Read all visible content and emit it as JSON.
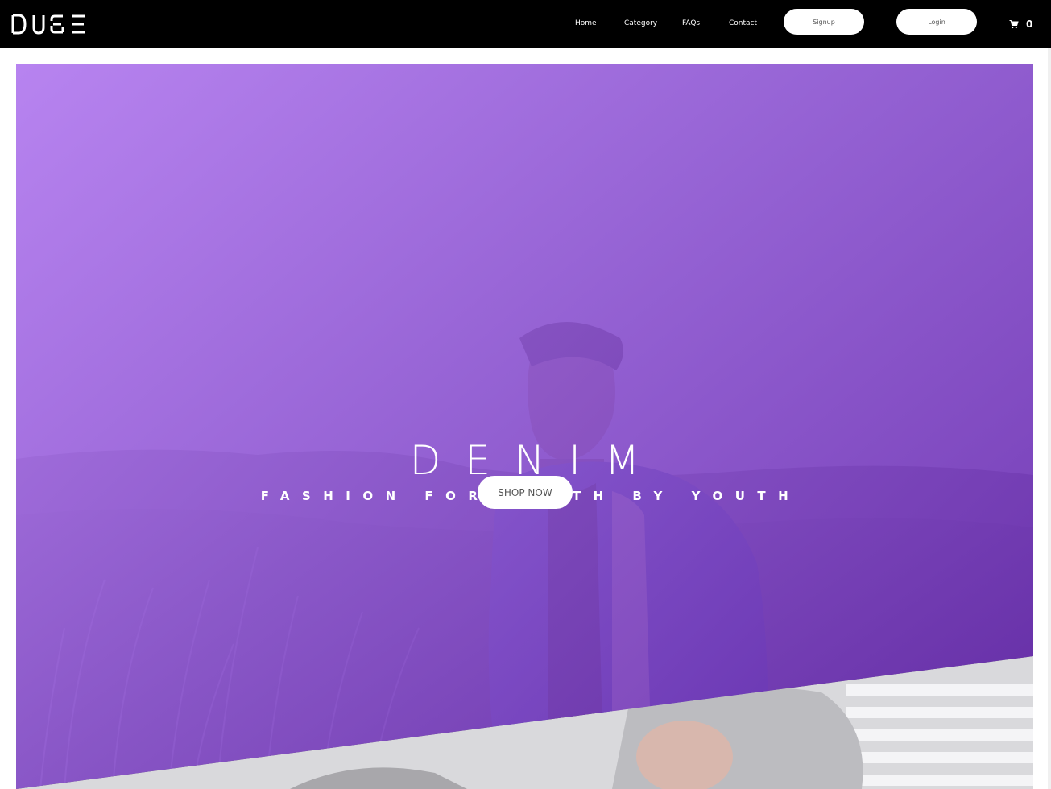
{
  "nav": {
    "logo_text": "DUSE",
    "links": [
      {
        "label": "Home"
      },
      {
        "label": "Category"
      },
      {
        "label": "FAQs"
      },
      {
        "label": "Contact"
      }
    ],
    "signup_label": "Signup",
    "login_label": "Login",
    "cart_icon": "shopping-cart-icon",
    "cart_count": "0"
  },
  "hero": {
    "title": "DENIM",
    "subtitle": "FASHION FOR YOUTH BY YOUTH",
    "cta_label": "SHOP NOW"
  },
  "colors": {
    "nav_bg": "#000000",
    "hero_gradient_start": "#b67ef2",
    "hero_gradient_end": "#6828b2",
    "button_bg": "#ffffff"
  }
}
